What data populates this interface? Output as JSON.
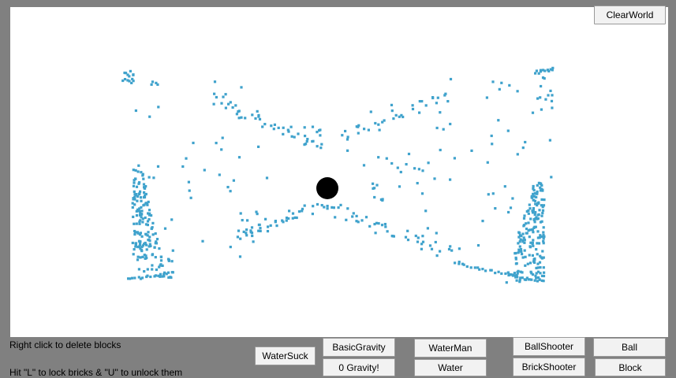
{
  "buttons": {
    "clear_world": "ClearWorld",
    "water_suck": "WaterSuck",
    "basic_gravity": "BasicGravity",
    "zero_gravity": "0 Gravity!",
    "water_man": "WaterMan",
    "water": "Water",
    "ball_shooter": "BallShooter",
    "brick_shooter": "BrickShooter",
    "ball": "Ball",
    "block": "Block"
  },
  "instructions": {
    "delete_hint": "Right click to delete blocks",
    "lock_hint": "Hit \"L\" to lock bricks & \"U\" to unlock them"
  },
  "colors": {
    "canvas_background": "#ffffff",
    "frame_background": "#808080",
    "water_particle": "#3fa2cc",
    "ball": "#000000"
  }
}
